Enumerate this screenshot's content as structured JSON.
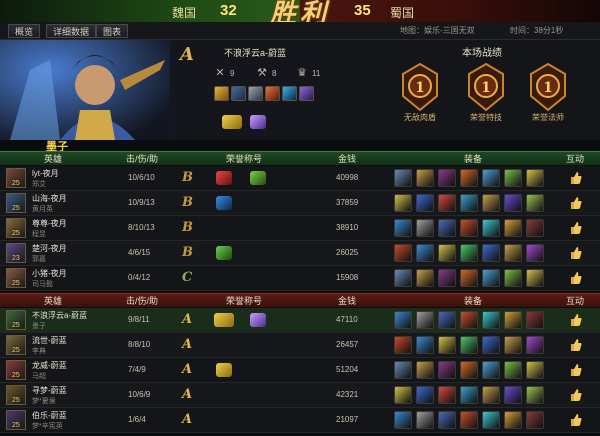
{
  "scorebar": {
    "team_a": "魏国",
    "score_a": "32",
    "score_b": "35",
    "team_b": "蜀国",
    "result": "胜利"
  },
  "tabs": [
    {
      "label": "概览"
    },
    {
      "label": "详细数据"
    },
    {
      "label": "图表"
    }
  ],
  "map": "地图：娱乐-三国无双",
  "time": "时间：38分1秒",
  "mvp": {
    "grade": "A",
    "player": "不浪浮云a-蔚蓝",
    "kills": "9",
    "assists_icon_value": "8",
    "third_value": "11"
  },
  "performance": {
    "title": "本场战绩",
    "medals": [
      {
        "label": "无敌肉盾"
      },
      {
        "label": "荣誉特技"
      },
      {
        "label": "荣誉法师"
      }
    ]
  },
  "team_label": "墨子",
  "headers": {
    "hero": "英雄",
    "kda": "击/伤/助",
    "honor": "荣誉称号",
    "gold": "金钱",
    "equip": "装备",
    "interact": "互动"
  },
  "team_a_rows": [
    {
      "player": "lyt-夜月",
      "hero": "郑艾",
      "level": "25",
      "kda": "10/6/10",
      "grade": "B",
      "gold": "40998"
    },
    {
      "player": "山海-夜月",
      "hero": "黄月英",
      "level": "25",
      "kda": "10/9/13",
      "grade": "B",
      "gold": "37859"
    },
    {
      "player": "尊尊-夜月",
      "hero": "程昱",
      "level": "25",
      "kda": "8/10/13",
      "grade": "B",
      "gold": "38910"
    },
    {
      "player": "楚河-夜月",
      "hero": "郭嘉",
      "level": "23",
      "kda": "4/6/15",
      "grade": "B",
      "gold": "26025"
    },
    {
      "player": "小猪-夜月",
      "hero": "司马懿",
      "level": "25",
      "kda": "0/4/12",
      "grade": "C",
      "gold": "15908"
    }
  ],
  "team_b_rows": [
    {
      "player": "不浪浮云a-蔚蓝",
      "hero": "墨子",
      "level": "25",
      "kda": "9/8/11",
      "grade": "A",
      "gold": "47110"
    },
    {
      "player": "流世-蔚蓝",
      "hero": "李典",
      "level": "25",
      "kda": "8/8/10",
      "grade": "A",
      "gold": "26457"
    },
    {
      "player": "龙威-蔚蓝",
      "hero": "马超",
      "level": "25",
      "kda": "7/4/9",
      "grade": "A",
      "gold": "51204"
    },
    {
      "player": "寻梦-蔚蓝",
      "hero": "梦*夏侯",
      "level": "25",
      "kda": "10/6/9",
      "grade": "A",
      "gold": "42321"
    },
    {
      "player": "伯乐-蔚蓝",
      "hero": "梦*辛宪英",
      "level": "25",
      "kda": "1/6/4",
      "grade": "A",
      "gold": "21097"
    }
  ],
  "colors": {
    "grade_a": "#e0b84a",
    "grade_b": "#c79a3a",
    "grade_c": "#8fae4a",
    "gold_text": "#ffe57a"
  }
}
